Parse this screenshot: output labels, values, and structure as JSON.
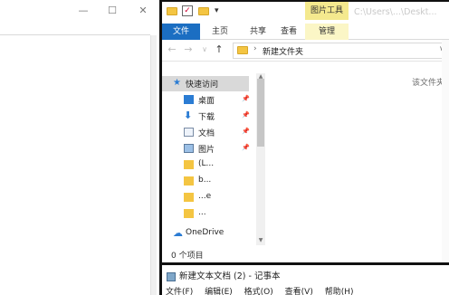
{
  "left_window": {
    "controls": {
      "minimize": "—",
      "maximize": "☐",
      "close": "✕"
    }
  },
  "right_window": {
    "title_path": "C:\\Users\\...\\Deskt...",
    "context_tab_header": "图片工具",
    "ribbon_tabs": [
      "文件",
      "主页",
      "共享",
      "查看",
      "管理"
    ],
    "address": {
      "current_folder": "新建文件夹",
      "separator": "›"
    },
    "nav_arrows": {
      "back": "←",
      "forward": "→",
      "recent": "∨",
      "up": "↑"
    },
    "navpane": {
      "quick_access": "快速访问",
      "items": [
        {
          "label": "桌面",
          "icon": "desktop-icon",
          "pinned": true
        },
        {
          "label": "下载",
          "icon": "download-icon",
          "pinned": true
        },
        {
          "label": "文档",
          "icon": "document-icon",
          "pinned": true
        },
        {
          "label": "图片",
          "icon": "pictures-icon",
          "pinned": true
        },
        {
          "label": "(L...",
          "icon": "folder-icon",
          "pinned": false
        },
        {
          "label": "b...",
          "icon": "folder-icon",
          "pinned": false
        },
        {
          "label": "...e",
          "icon": "folder-icon",
          "pinned": false
        },
        {
          "label": "...",
          "icon": "folder-icon",
          "pinned": false
        }
      ],
      "onedrive": "OneDrive"
    },
    "empty_message": "该文件夹为空。",
    "status": "0 个项目"
  },
  "notepad": {
    "title": "新建文本文档 (2) - 记事本",
    "menu": [
      "文件(F)",
      "编辑(E)",
      "格式(O)",
      "查看(V)",
      "帮助(H)"
    ]
  },
  "colors": {
    "ribbon_file": "#1b6ec2",
    "context_tab": "#f4e98e",
    "folder": "#f4c542"
  }
}
